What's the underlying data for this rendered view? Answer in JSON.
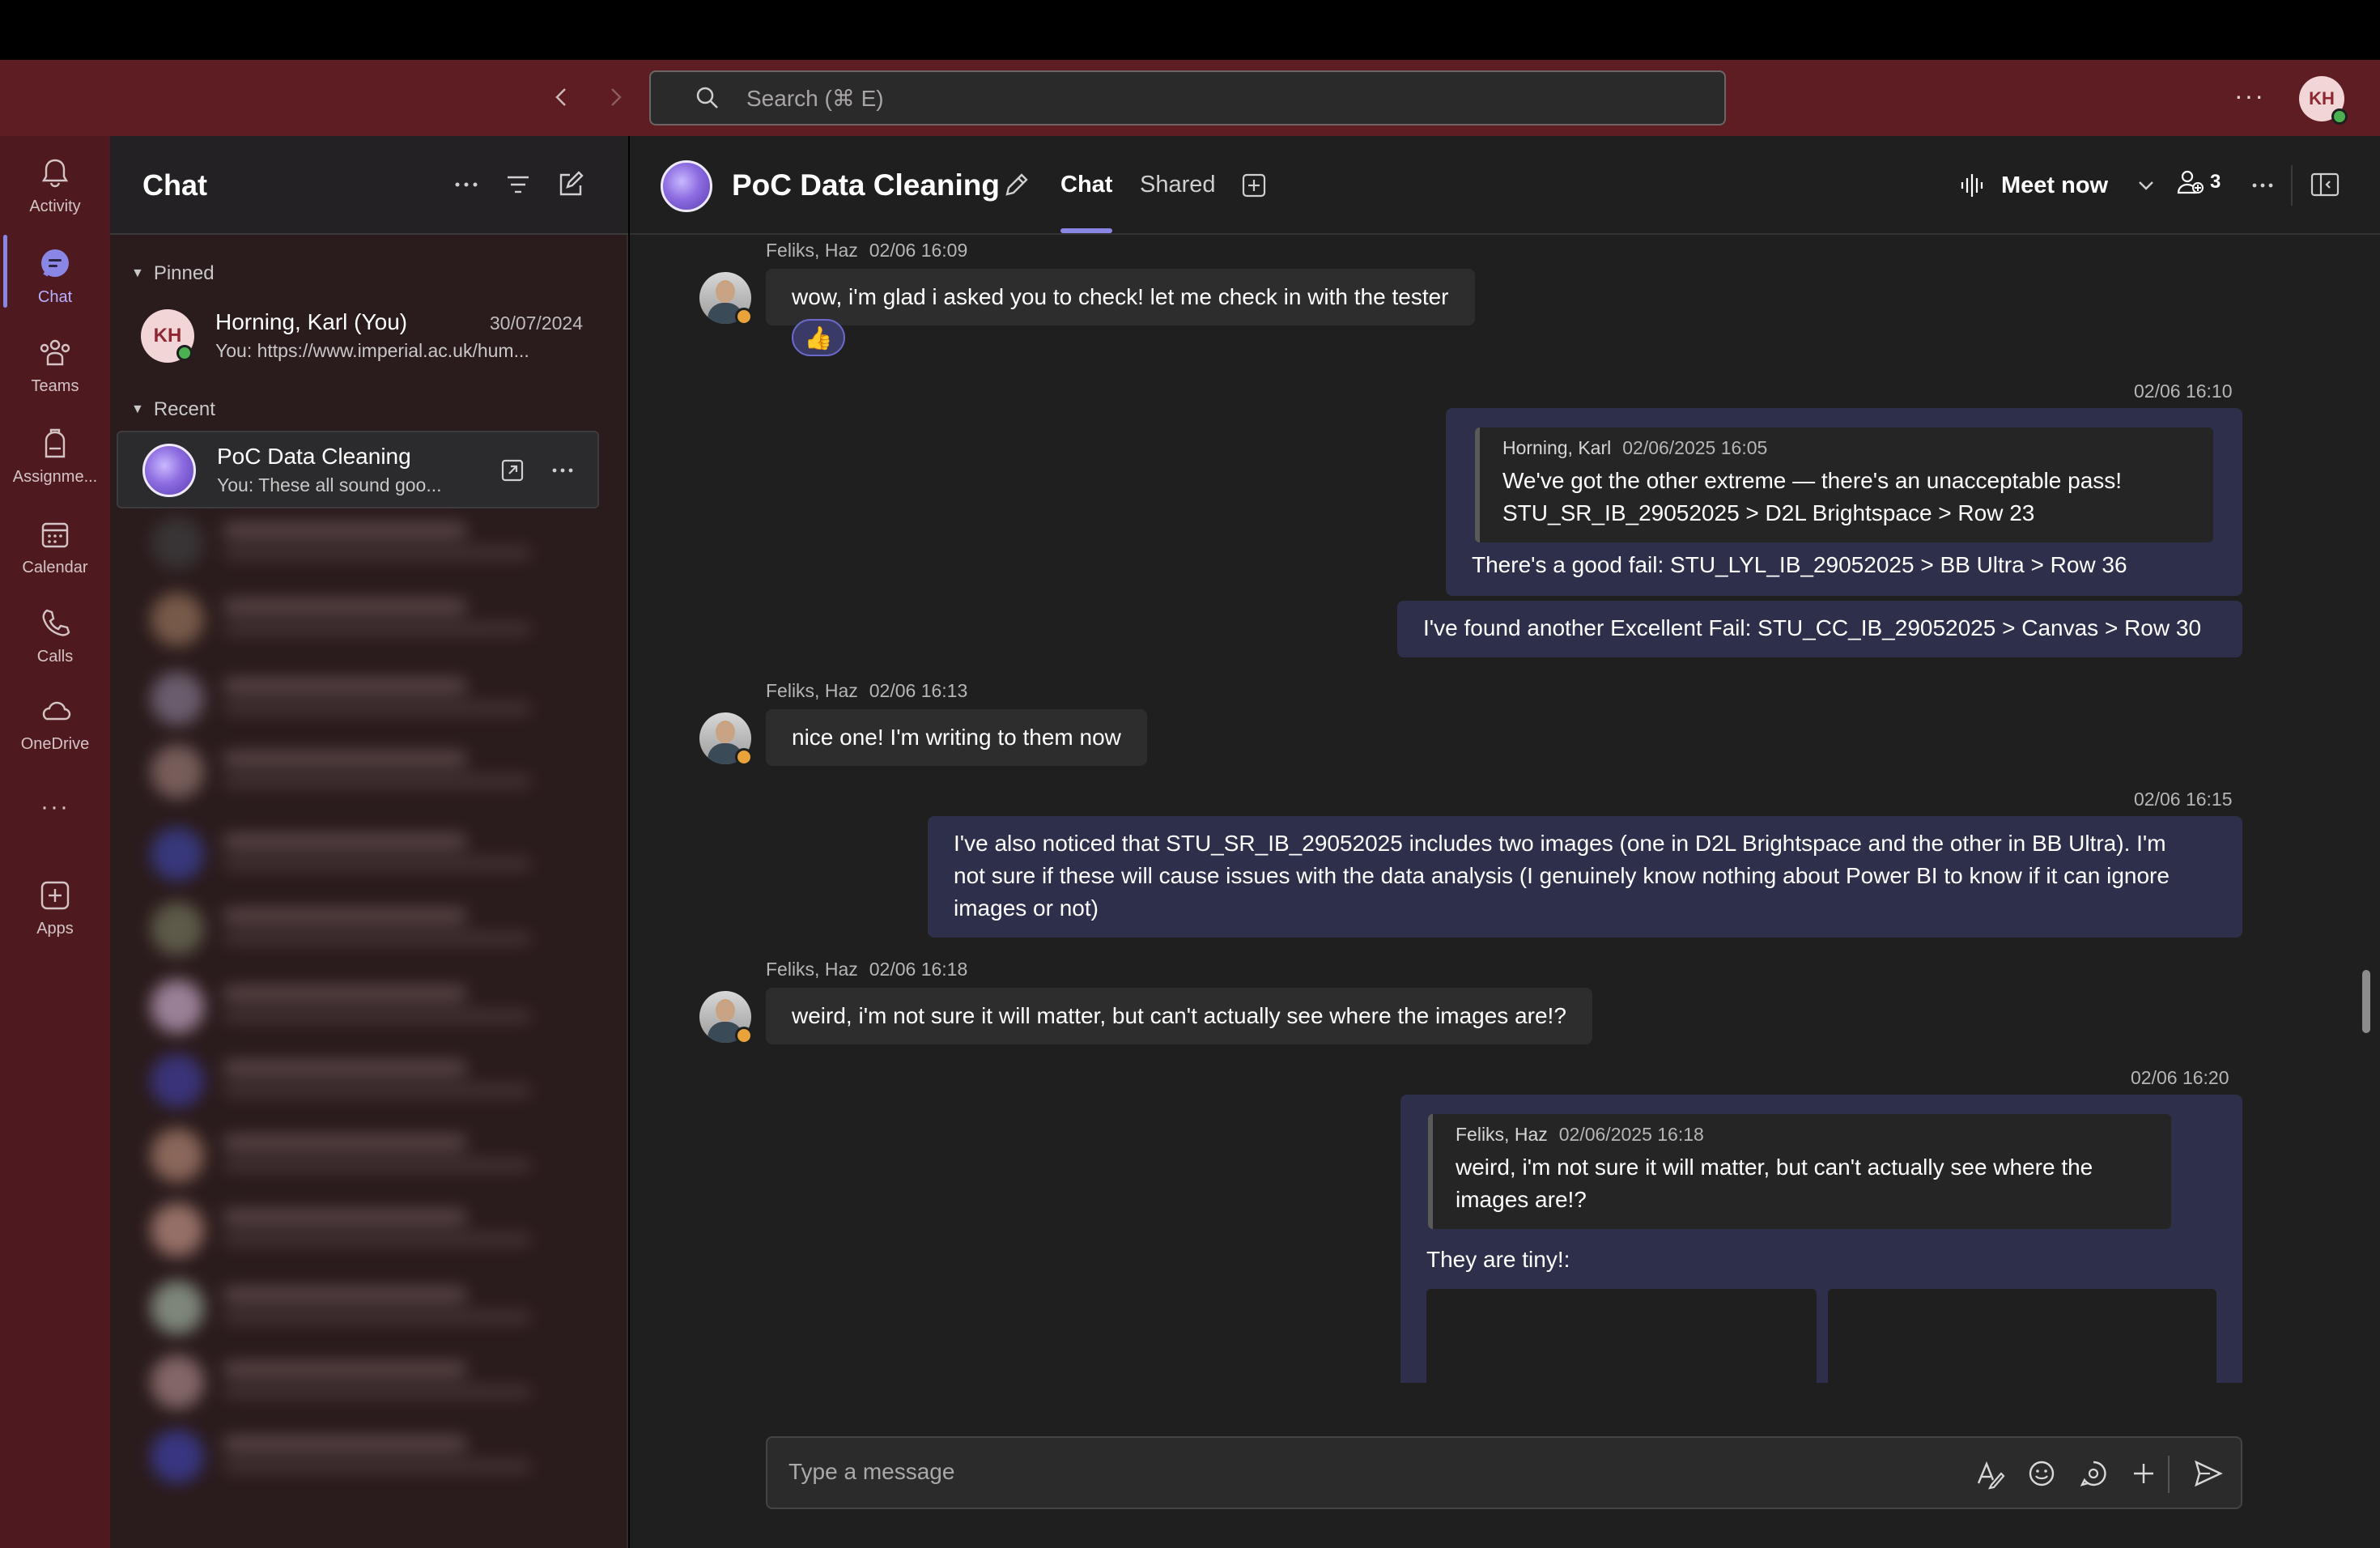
{
  "titlebar": {
    "search_placeholder": "Search (⌘ E)",
    "more_label": "···",
    "user_initials": "KH"
  },
  "rail": {
    "items": [
      {
        "label": "Activity",
        "icon": "bell-icon"
      },
      {
        "label": "Chat",
        "icon": "chat-icon"
      },
      {
        "label": "Teams",
        "icon": "teams-icon"
      },
      {
        "label": "Assignme...",
        "icon": "backpack-icon"
      },
      {
        "label": "Calendar",
        "icon": "calendar-icon"
      },
      {
        "label": "Calls",
        "icon": "phone-icon"
      },
      {
        "label": "OneDrive",
        "icon": "cloud-icon"
      },
      {
        "label": "···",
        "icon": "more-icon"
      },
      {
        "label": "Apps",
        "icon": "add-app-icon"
      }
    ]
  },
  "chatlist": {
    "title": "Chat",
    "pinned_label": "Pinned",
    "recent_label": "Recent",
    "pinned": [
      {
        "name": "Horning, Karl (You)",
        "date": "30/07/2024",
        "preview": "You: https://www.imperial.ac.uk/hum...",
        "initials": "KH"
      }
    ],
    "recent": [
      {
        "name": "PoC Data Cleaning",
        "preview": "You: These all sound goo..."
      }
    ]
  },
  "conversation": {
    "title": "PoC Data Cleaning",
    "tabs": {
      "chat": "Chat",
      "shared": "Shared"
    },
    "meet_now": "Meet now",
    "participants_count": "3",
    "composer_placeholder": "Type a message",
    "messages": {
      "m1": {
        "sender": "Feliks, Haz",
        "time": "02/06 16:09",
        "text": "wow, i'm glad i asked you to check! let me check in with the tester",
        "reaction": "👍"
      },
      "m2": {
        "time": "02/06 16:10",
        "quote_sender": "Horning, Karl",
        "quote_time": "02/06/2025 16:05",
        "quote_line1": "We've got the other extreme — there's an unacceptable pass!",
        "quote_line2": "STU_SR_IB_29052025 > D2L Brightspace > Row 23",
        "text": "There's a good fail: STU_LYL_IB_29052025 > BB Ultra > Row 36"
      },
      "m3": {
        "text": "I've found another Excellent Fail: STU_CC_IB_29052025 > Canvas > Row 30"
      },
      "m4": {
        "sender": "Feliks, Haz",
        "time": "02/06 16:13",
        "text": "nice one! I'm writing to them now"
      },
      "m5": {
        "time": "02/06 16:15",
        "line1": "I've also noticed that STU_SR_IB_29052025 includes two images (one in D2L Brightspace and the other in BB Ultra). I'm",
        "line2": "not sure if these will cause issues with the data analysis (I genuinely know nothing about Power BI to know if it can ignore",
        "line3": "images or not)"
      },
      "m6": {
        "sender": "Feliks, Haz",
        "time": "02/06 16:18",
        "text": "weird, i'm  not sure it will matter, but can't actually see where the images are!?"
      },
      "m7": {
        "time": "02/06 16:20",
        "quote_sender": "Feliks, Haz",
        "quote_time": "02/06/2025 16:18",
        "quote_line1": "weird, i'm not sure it will matter, but can't actually see where the",
        "quote_line2": "images are!?",
        "text": "They are tiny!:"
      }
    }
  },
  "colors": {
    "titlebar": "#5e1d22",
    "rail": "#4f1a1f",
    "accent": "#8a86e6",
    "outgoing_bubble": "#2e2f4a",
    "incoming_bubble": "#2d2d2d"
  }
}
